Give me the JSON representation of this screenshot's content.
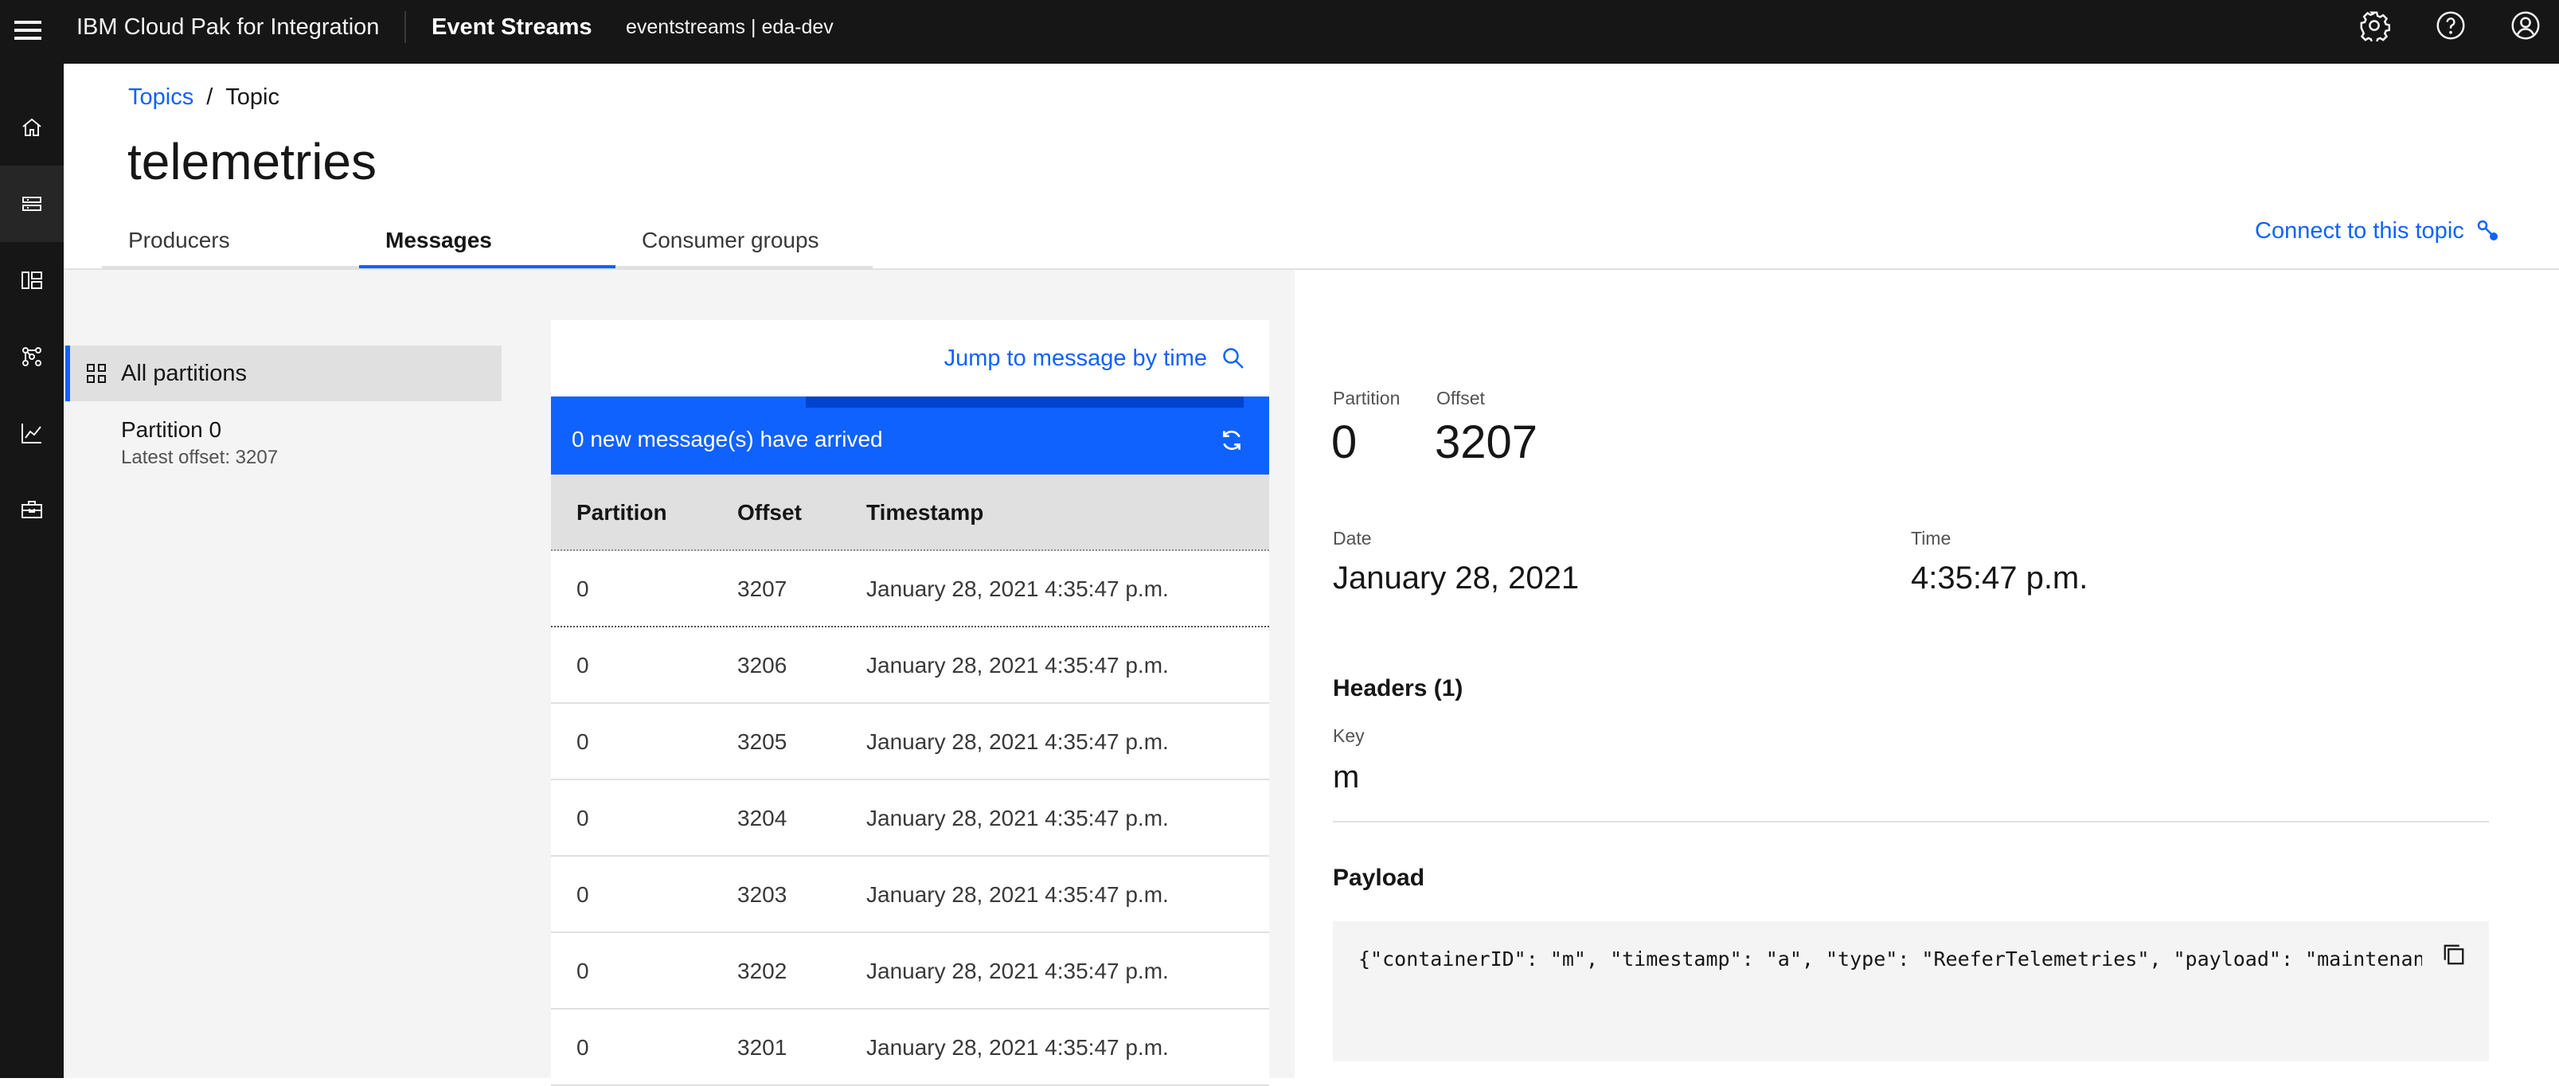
{
  "header": {
    "brand": "IBM Cloud Pak for Integration",
    "product": "Event Streams",
    "instance": "eventstreams | eda-dev",
    "icons": [
      "menu-icon",
      "settings-icon",
      "help-icon",
      "user-avatar-icon"
    ]
  },
  "rail": {
    "icons": [
      "home-icon",
      "topics-icon",
      "schemas-icon",
      "consumer-groups-icon",
      "monitoring-icon",
      "toolbox-icon"
    ],
    "active_index": 1
  },
  "breadcrumb": {
    "link": "Topics",
    "separator": "/",
    "current": "Topic"
  },
  "page_title": "telemetries",
  "tabs": [
    {
      "label": "Producers",
      "active": false
    },
    {
      "label": "Messages",
      "active": true
    },
    {
      "label": "Consumer groups",
      "active": false
    }
  ],
  "connect_label": "Connect to this topic",
  "partitions": {
    "all_label": "All partitions",
    "items": [
      {
        "name": "Partition 0",
        "sub": "Latest offset: 3207"
      }
    ]
  },
  "messages": {
    "jump_label": "Jump to message by time",
    "banner": "0 new message(s) have arrived",
    "columns": [
      "Partition",
      "Offset",
      "Timestamp"
    ],
    "rows": [
      {
        "partition": "0",
        "offset": "3207",
        "timestamp": "January 28, 2021 4:35:47 p.m."
      },
      {
        "partition": "0",
        "offset": "3206",
        "timestamp": "January 28, 2021 4:35:47 p.m."
      },
      {
        "partition": "0",
        "offset": "3205",
        "timestamp": "January 28, 2021 4:35:47 p.m."
      },
      {
        "partition": "0",
        "offset": "3204",
        "timestamp": "January 28, 2021 4:35:47 p.m."
      },
      {
        "partition": "0",
        "offset": "3203",
        "timestamp": "January 28, 2021 4:35:47 p.m."
      },
      {
        "partition": "0",
        "offset": "3202",
        "timestamp": "January 28, 2021 4:35:47 p.m."
      },
      {
        "partition": "0",
        "offset": "3201",
        "timestamp": "January 28, 2021 4:35:47 p.m."
      }
    ]
  },
  "detail": {
    "partition_label": "Partition",
    "partition_value": "0",
    "offset_label": "Offset",
    "offset_value": "3207",
    "date_label": "Date",
    "date_value": "January 28, 2021",
    "time_label": "Time",
    "time_value": "4:35:47 p.m.",
    "headers_title": "Headers (1)",
    "key_label": "Key",
    "key_value": "m",
    "payload_title": "Payload",
    "payload_text": "{\"containerID\": \"m\", \"timestamp\": \"a\", \"type\": \"ReeferTelemetries\", \"payload\": \"maintenan"
  },
  "colors": {
    "accent": "#0f62fe",
    "topbar": "#161616",
    "panel_bg": "#f4f4f4"
  }
}
